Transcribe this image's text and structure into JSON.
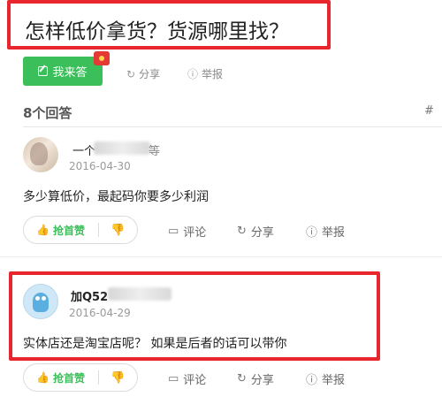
{
  "question": {
    "title": "怎样低价拿货？货源哪里找？",
    "answer_label": "我来答",
    "share_label": "分享",
    "report_label": "举报"
  },
  "answers_count": "8个回答",
  "sort_hint": "#",
  "answers": [
    {
      "name_prefix": "一个",
      "name_suffix": "等",
      "date": "2016-04-30",
      "text": "多少算低价，最起码你要多少利润",
      "like_label": "抢首赞",
      "comment_label": "评论",
      "share_label": "分享",
      "report_label": "举报"
    },
    {
      "name_prefix": "加Q52",
      "name_suffix": "",
      "date": "2016-04-29",
      "text": "实体店还是淘宝店呢？ 如果是后者的话可以带你",
      "like_label": "抢首赞",
      "comment_label": "评论",
      "share_label": "分享",
      "report_label": "举报"
    }
  ],
  "icons": {
    "share": "↻",
    "report": "ⓘ",
    "comment": "▭",
    "thumb_up": "👍",
    "thumb_down": "👎"
  },
  "colors": {
    "accent_green": "#3bbf5a",
    "highlight_red": "#e8262d"
  }
}
